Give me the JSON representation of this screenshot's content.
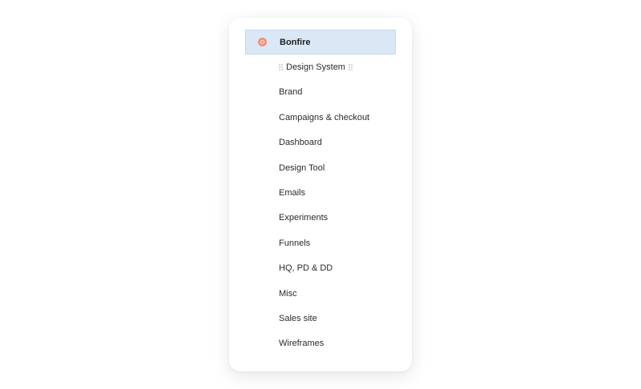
{
  "menu": {
    "header": {
      "label": "Bonfire",
      "icon": "bonfire-dot-icon",
      "icon_color": "#f4907a",
      "selected_bg": "#dae8f6"
    },
    "drag_item": {
      "label": "Design System",
      "handle_icon": "drag-handle-icon"
    },
    "items": [
      {
        "label": "Brand"
      },
      {
        "label": "Campaigns & checkout"
      },
      {
        "label": "Dashboard"
      },
      {
        "label": "Design Tool"
      },
      {
        "label": "Emails"
      },
      {
        "label": "Experiments"
      },
      {
        "label": "Funnels"
      },
      {
        "label": "HQ, PD & DD"
      },
      {
        "label": "Misc"
      },
      {
        "label": "Sales site"
      },
      {
        "label": "Wireframes"
      }
    ]
  }
}
